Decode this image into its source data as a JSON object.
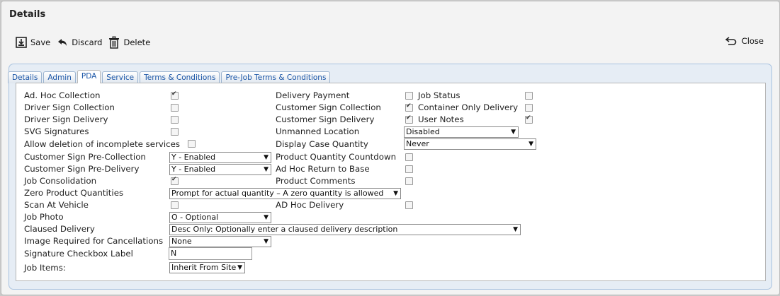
{
  "window": {
    "title": "Details"
  },
  "toolbar": {
    "save_label": "Save",
    "discard_label": "Discard",
    "delete_label": "Delete",
    "close_label": "Close"
  },
  "tabs": [
    "Details",
    "Admin",
    "PDA",
    "Service",
    "Terms & Conditions",
    "Pre-Job Terms & Conditions"
  ],
  "active_tab": "PDA",
  "left": {
    "ad_hoc_collection": {
      "label": "Ad. Hoc Collection",
      "checked": true
    },
    "driver_sign_collection": {
      "label": "Driver Sign Collection",
      "checked": false
    },
    "driver_sign_delivery": {
      "label": "Driver Sign Delivery",
      "checked": false
    },
    "svg_signatures": {
      "label": "SVG Signatures",
      "checked": false
    },
    "allow_deletion": {
      "label": "Allow deletion of incomplete services",
      "checked": false
    },
    "customer_sign_pre_collection": {
      "label": "Customer Sign Pre-Collection",
      "value": "Y - Enabled"
    },
    "customer_sign_pre_delivery": {
      "label": "Customer Sign Pre-Delivery",
      "value": "Y - Enabled"
    },
    "job_consolidation": {
      "label": "Job Consolidation",
      "checked": true
    },
    "zero_product_quantities": {
      "label": "Zero Product Quantities",
      "value": "Prompt for actual quantity – A zero quantity is allowed"
    },
    "scan_at_vehicle": {
      "label": "Scan At Vehicle",
      "checked": false
    },
    "job_photo": {
      "label": "Job Photo",
      "value": "O - Optional"
    },
    "claused_delivery": {
      "label": "Claused Delivery",
      "value": "Desc Only: Optionally enter a claused delivery description"
    },
    "image_required": {
      "label": "Image Required for Cancellations",
      "value": "None"
    },
    "signature_checkbox_label": {
      "label": "Signature Checkbox Label",
      "value": "N"
    },
    "job_items": {
      "label": "Job Items:",
      "value": "Inherit From Site"
    }
  },
  "middle": {
    "delivery_payment": {
      "label": "Delivery Payment",
      "checked": false
    },
    "customer_sign_collection": {
      "label": "Customer Sign Collection",
      "checked": true
    },
    "customer_sign_delivery": {
      "label": "Customer Sign Delivery",
      "checked": true
    },
    "unmanned_location": {
      "label": "Unmanned Location",
      "value": "Disabled"
    },
    "display_case_quantity": {
      "label": "Display Case Quantity",
      "value": "Never"
    },
    "product_quantity_countdown": {
      "label": "Product Quantity Countdown",
      "checked": false
    },
    "ad_hoc_return_to_base": {
      "label": "Ad Hoc Return to Base",
      "checked": false
    },
    "product_comments": {
      "label": "Product Comments",
      "checked": false
    },
    "ad_hoc_delivery": {
      "label": "AD Hoc Delivery",
      "checked": false
    }
  },
  "right": {
    "job_status": {
      "label": "Job Status",
      "checked": false
    },
    "container_only_delivery": {
      "label": "Container Only Delivery",
      "checked": false
    },
    "user_notes": {
      "label": "User Notes",
      "checked": true
    }
  }
}
